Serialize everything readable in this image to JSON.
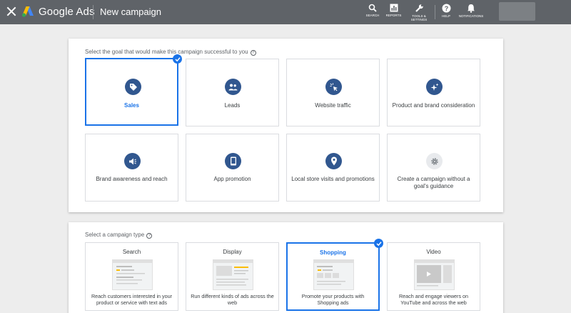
{
  "header": {
    "brand": "Google Ads",
    "page_title": "New campaign",
    "tools": [
      {
        "label": "SEARCH",
        "icon": "search-icon"
      },
      {
        "label": "REPORTS",
        "icon": "reports-icon"
      },
      {
        "label": "TOOLS &\nSETTINGS",
        "icon": "wrench-icon"
      },
      {
        "label": "HELP",
        "icon": "help-icon"
      },
      {
        "label": "NOTIFICATIONS",
        "icon": "bell-icon"
      }
    ]
  },
  "goals": {
    "prompt": "Select the goal that would make this campaign successful to you",
    "selected": "Sales",
    "items": [
      {
        "label": "Sales",
        "icon": "tag-icon"
      },
      {
        "label": "Leads",
        "icon": "people-icon"
      },
      {
        "label": "Website traffic",
        "icon": "cursor-click-icon"
      },
      {
        "label": "Product and brand consideration",
        "icon": "sparkle-icon"
      },
      {
        "label": "Brand awareness and reach",
        "icon": "speaker-icon"
      },
      {
        "label": "App promotion",
        "icon": "phone-icon"
      },
      {
        "label": "Local store visits and promotions",
        "icon": "location-pin-icon"
      },
      {
        "label": "Create a campaign without a goal's guidance",
        "icon": "gear-icon"
      }
    ]
  },
  "campaign_types": {
    "prompt": "Select a campaign type",
    "selected": "Shopping",
    "items": [
      {
        "title": "Search",
        "description": "Reach customers interested in your product or service with text ads"
      },
      {
        "title": "Display",
        "description": "Run different kinds of ads across the web"
      },
      {
        "title": "Shopping",
        "description": "Promote your products with Shopping ads"
      },
      {
        "title": "Video",
        "description": "Reach and engage viewers on YouTube and across the web"
      }
    ]
  },
  "colors": {
    "header_bg": "#5f6368",
    "accent": "#1a73e8",
    "icon_circle": "#31578f",
    "page_bg": "#ededed"
  }
}
